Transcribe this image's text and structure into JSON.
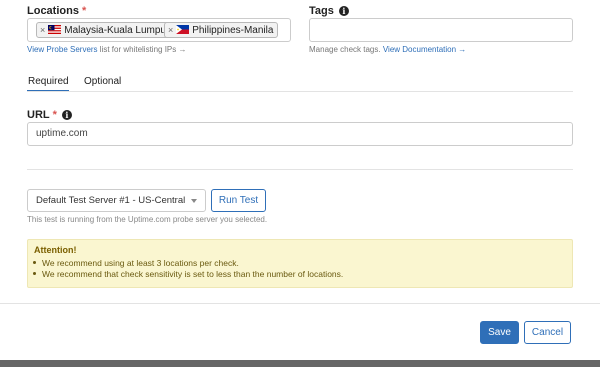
{
  "locations": {
    "label": "Locations",
    "required_mark": "*",
    "tags": [
      {
        "label": "Malaysia-Kuala Lumpur",
        "remove": "×",
        "flag_icon": "malaysia-flag-icon"
      },
      {
        "label": "Philippines-Manila",
        "remove": "×",
        "flag_icon": "philippines-flag-icon"
      }
    ],
    "help_link": "View Probe Servers",
    "help_suffix": "list for whitelisting IPs →"
  },
  "tags_field": {
    "label": "Tags",
    "info_icon": "i",
    "value": "",
    "help_text": "Manage check tags.",
    "help_link": "View Documentation →"
  },
  "tabs": [
    {
      "label": "Required",
      "active": true
    },
    {
      "label": "Optional",
      "active": false
    }
  ],
  "url_field": {
    "label": "URL",
    "required_mark": "*",
    "info_icon": "i",
    "value": "uptime.com"
  },
  "test_server": {
    "selected": "Default Test Server #1 - US-Central",
    "run_button": "Run Test",
    "note": "This test is running from the Uptime.com probe server you selected."
  },
  "attention": {
    "title": "Attention!",
    "items": [
      "We recommend using at least 3 locations per check.",
      "We recommend that check sensitivity is set to less than the number of locations."
    ]
  },
  "footer": {
    "save": "Save",
    "cancel": "Cancel"
  },
  "colors": {
    "primary": "#2f6fb8",
    "required": "#d9534f",
    "alert_bg": "#faf6d0",
    "bottom_bar": "#666666"
  }
}
